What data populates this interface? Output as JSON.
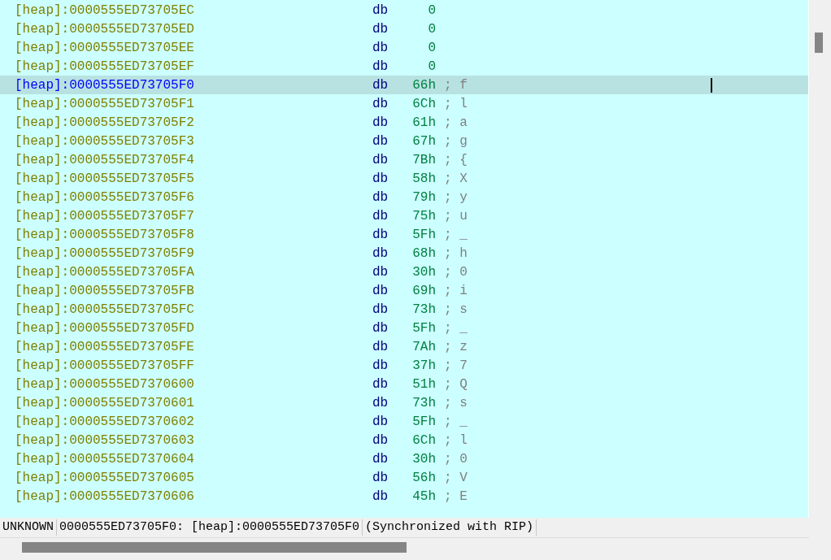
{
  "listing": {
    "rows": [
      {
        "address": "[heap]:0000555ED73705EC",
        "directive": "db",
        "value": "0",
        "comment": "",
        "selected": false
      },
      {
        "address": "[heap]:0000555ED73705ED",
        "directive": "db",
        "value": "0",
        "comment": "",
        "selected": false
      },
      {
        "address": "[heap]:0000555ED73705EE",
        "directive": "db",
        "value": "0",
        "comment": "",
        "selected": false
      },
      {
        "address": "[heap]:0000555ED73705EF",
        "directive": "db",
        "value": "0",
        "comment": "",
        "selected": false
      },
      {
        "address": "[heap]:0000555ED73705F0",
        "directive": "db",
        "value": "66h",
        "comment": "; f",
        "selected": true
      },
      {
        "address": "[heap]:0000555ED73705F1",
        "directive": "db",
        "value": "6Ch",
        "comment": "; l",
        "selected": false
      },
      {
        "address": "[heap]:0000555ED73705F2",
        "directive": "db",
        "value": "61h",
        "comment": "; a",
        "selected": false
      },
      {
        "address": "[heap]:0000555ED73705F3",
        "directive": "db",
        "value": "67h",
        "comment": "; g",
        "selected": false
      },
      {
        "address": "[heap]:0000555ED73705F4",
        "directive": "db",
        "value": "7Bh",
        "comment": "; {",
        "selected": false
      },
      {
        "address": "[heap]:0000555ED73705F5",
        "directive": "db",
        "value": "58h",
        "comment": "; X",
        "selected": false
      },
      {
        "address": "[heap]:0000555ED73705F6",
        "directive": "db",
        "value": "79h",
        "comment": "; y",
        "selected": false
      },
      {
        "address": "[heap]:0000555ED73705F7",
        "directive": "db",
        "value": "75h",
        "comment": "; u",
        "selected": false
      },
      {
        "address": "[heap]:0000555ED73705F8",
        "directive": "db",
        "value": "5Fh",
        "comment": "; _",
        "selected": false
      },
      {
        "address": "[heap]:0000555ED73705F9",
        "directive": "db",
        "value": "68h",
        "comment": "; h",
        "selected": false
      },
      {
        "address": "[heap]:0000555ED73705FA",
        "directive": "db",
        "value": "30h",
        "comment": "; 0",
        "selected": false
      },
      {
        "address": "[heap]:0000555ED73705FB",
        "directive": "db",
        "value": "69h",
        "comment": "; i",
        "selected": false
      },
      {
        "address": "[heap]:0000555ED73705FC",
        "directive": "db",
        "value": "73h",
        "comment": "; s",
        "selected": false
      },
      {
        "address": "[heap]:0000555ED73705FD",
        "directive": "db",
        "value": "5Fh",
        "comment": "; _",
        "selected": false
      },
      {
        "address": "[heap]:0000555ED73705FE",
        "directive": "db",
        "value": "7Ah",
        "comment": "; z",
        "selected": false
      },
      {
        "address": "[heap]:0000555ED73705FF",
        "directive": "db",
        "value": "37h",
        "comment": "; 7",
        "selected": false
      },
      {
        "address": "[heap]:0000555ED7370600",
        "directive": "db",
        "value": "51h",
        "comment": "; Q",
        "selected": false
      },
      {
        "address": "[heap]:0000555ED7370601",
        "directive": "db",
        "value": "73h",
        "comment": "; s",
        "selected": false
      },
      {
        "address": "[heap]:0000555ED7370602",
        "directive": "db",
        "value": "5Fh",
        "comment": "; _",
        "selected": false
      },
      {
        "address": "[heap]:0000555ED7370603",
        "directive": "db",
        "value": "6Ch",
        "comment": "; l",
        "selected": false
      },
      {
        "address": "[heap]:0000555ED7370604",
        "directive": "db",
        "value": "30h",
        "comment": "; 0",
        "selected": false
      },
      {
        "address": "[heap]:0000555ED7370605",
        "directive": "db",
        "value": "56h",
        "comment": "; V",
        "selected": false
      },
      {
        "address": "[heap]:0000555ED7370606",
        "directive": "db",
        "value": "45h",
        "comment": "; E",
        "selected": false
      }
    ]
  },
  "status_bar": {
    "cells": [
      "UNKNOWN",
      "0000555ED73705F0: [heap]:0000555ED73705F0",
      "(Synchronized with RIP)"
    ]
  }
}
